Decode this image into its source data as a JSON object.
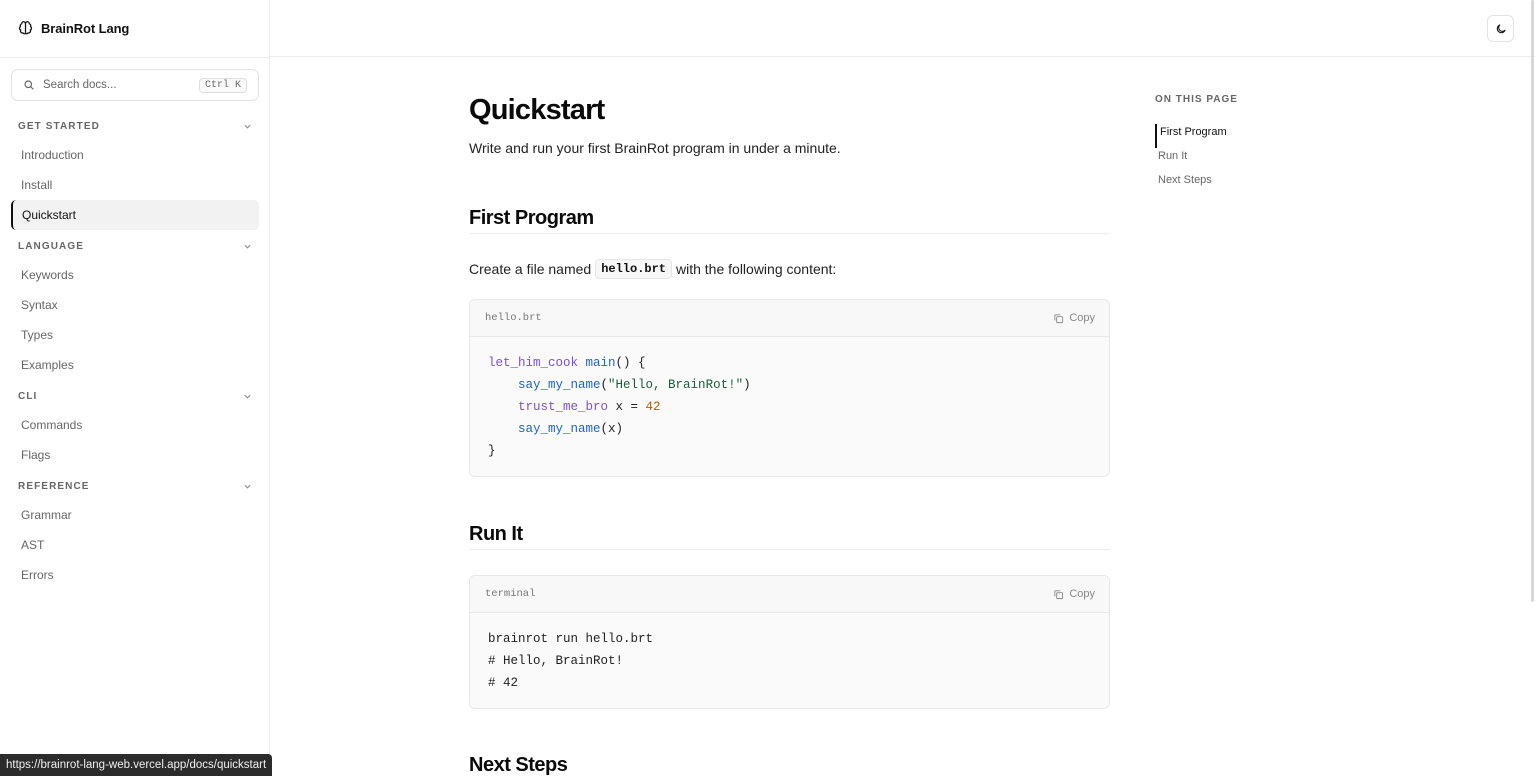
{
  "brand": {
    "name": "BrainRot Lang",
    "icon": "brain-icon"
  },
  "search": {
    "placeholder": "Search docs...",
    "shortcut": "Ctrl K",
    "icon": "search-icon"
  },
  "sidebar": {
    "sections": [
      {
        "title": "GET STARTED",
        "items": [
          "Introduction",
          "Install",
          "Quickstart"
        ]
      },
      {
        "title": "LANGUAGE",
        "items": [
          "Keywords",
          "Syntax",
          "Types",
          "Examples"
        ]
      },
      {
        "title": "CLI",
        "items": [
          "Commands",
          "Flags"
        ]
      },
      {
        "title": "REFERENCE",
        "items": [
          "Grammar",
          "AST",
          "Errors"
        ]
      }
    ],
    "active_item": "Quickstart"
  },
  "topbar": {
    "theme_toggle_icon": "moon-icon"
  },
  "page": {
    "title": "Quickstart",
    "subtitle": "Write and run your first BrainRot program in under a minute.",
    "sections": {
      "first_program": {
        "heading": "First Program",
        "intro_before": "Create a file named",
        "intro_code": "hello.brt",
        "intro_after": "with the following content:",
        "code": {
          "filename": "hello.brt",
          "copy_label": "Copy",
          "lines": [
            [
              {
                "t": "let_him_cook",
                "c": "kw"
              },
              {
                "t": " ",
                "c": "pun"
              },
              {
                "t": "main",
                "c": "fn"
              },
              {
                "t": "() {",
                "c": "pun"
              }
            ],
            [
              {
                "t": "    ",
                "c": "pun"
              },
              {
                "t": "say_my_name",
                "c": "fn"
              },
              {
                "t": "(",
                "c": "pun"
              },
              {
                "t": "\"Hello, BrainRot!\"",
                "c": "str"
              },
              {
                "t": ")",
                "c": "pun"
              }
            ],
            [
              {
                "t": "    ",
                "c": "pun"
              },
              {
                "t": "trust_me_bro",
                "c": "kw"
              },
              {
                "t": " x = ",
                "c": "pun"
              },
              {
                "t": "42",
                "c": "num"
              }
            ],
            [
              {
                "t": "    ",
                "c": "pun"
              },
              {
                "t": "say_my_name",
                "c": "fn"
              },
              {
                "t": "(x)",
                "c": "pun"
              }
            ],
            [
              {
                "t": "}",
                "c": "pun"
              }
            ]
          ]
        }
      },
      "run_it": {
        "heading": "Run It",
        "code": {
          "filename": "terminal",
          "copy_label": "Copy",
          "lines": [
            [
              {
                "t": "brainrot run hello.brt",
                "c": "pun"
              }
            ],
            [
              {
                "t": "# Hello, BrainRot!",
                "c": "pun"
              }
            ],
            [
              {
                "t": "# 42",
                "c": "pun"
              }
            ]
          ]
        }
      },
      "next_steps": {
        "heading": "Next Steps"
      }
    }
  },
  "toc": {
    "title": "ON THIS PAGE",
    "items": [
      "First Program",
      "Run It",
      "Next Steps"
    ],
    "active_item": "First Program"
  },
  "status": {
    "url": "https://brainrot-lang-web.vercel.app/docs/quickstart"
  },
  "colors": {
    "keyword": "#7b4fd6",
    "function": "#2062c7",
    "string": "#1b5e3a",
    "number": "#b35c00",
    "active_border": "#111111"
  }
}
